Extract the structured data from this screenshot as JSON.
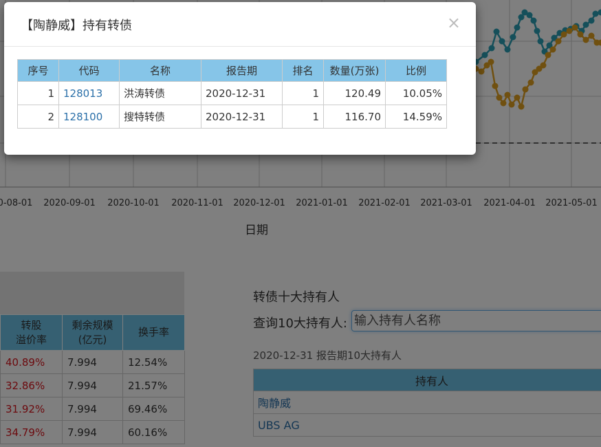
{
  "background": {
    "chart": {
      "x_ticks": [
        "0-08-01",
        "2020-09-01",
        "2020-10-01",
        "2020-11-01",
        "2020-12-01",
        "2021-01-01",
        "2021-02-01",
        "2021-03-01",
        "2021-04-01",
        "2021-05-01"
      ],
      "axis_label": "日期",
      "colors": {
        "teal": "#2a9fb5",
        "orange": "#e0a020",
        "grid": "#cccccc"
      }
    },
    "left_table": {
      "headers": [
        "转股\n溢价率",
        "剩余规模\n(亿元)",
        "换手率"
      ],
      "rows": [
        [
          "40.89%",
          "7.994",
          "12.54%"
        ],
        [
          "32.86%",
          "7.994",
          "21.57%"
        ],
        [
          "31.92%",
          "7.994",
          "69.46%"
        ],
        [
          "34.79%",
          "7.994",
          "60.16%"
        ]
      ]
    },
    "holders_panel": {
      "title": "转债十大持有人",
      "query_label": "查询10大持有人:",
      "query_placeholder": "输入持有人名称",
      "period_text": "2020-12-31 报告期10大持有人",
      "table_header": "持有人",
      "rows": [
        "陶静威",
        "UBS AG"
      ]
    }
  },
  "modal": {
    "title": "【陶静威】持有转债",
    "close_label": "×",
    "headers": [
      "序号",
      "代码",
      "名称",
      "报告期",
      "排名",
      "数量(万张)",
      "比例"
    ],
    "rows": [
      [
        "1",
        "128013",
        "洪涛转债",
        "2020-12-31",
        "1",
        "120.49",
        "10.05%"
      ],
      [
        "2",
        "128100",
        "搜特转债",
        "2020-12-31",
        "1",
        "116.70",
        "14.59%"
      ]
    ]
  }
}
